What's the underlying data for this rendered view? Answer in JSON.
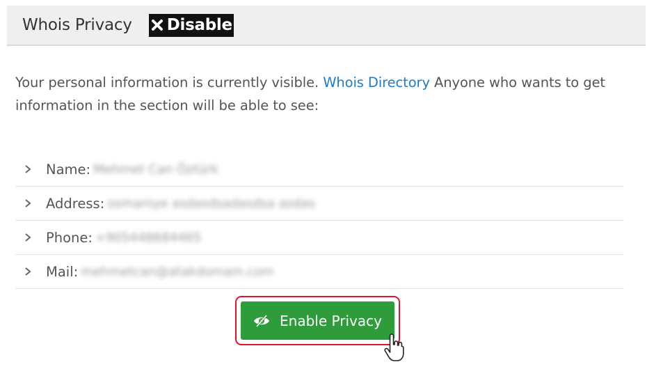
{
  "header": {
    "title": "Whois Privacy",
    "status_label": "Disable",
    "status_icon": "x-icon"
  },
  "intro": {
    "text_before": "Your personal information is currently visible. ",
    "link": "Whois Directory",
    "text_after": " Anyone who wants to get information in the section will be able to see:"
  },
  "fields": [
    {
      "label": "Name:",
      "value": "Mehmet Can Öztürk"
    },
    {
      "label": "Address:",
      "value": "osmaniye asdasdsadasdsa asdas"
    },
    {
      "label": "Phone:",
      "value": "+905448684465"
    },
    {
      "label": "Mail:",
      "value": "mehmetcan@atakdomain.com"
    }
  ],
  "action": {
    "button_label": "Enable Privacy",
    "button_icon": "eye-slash-icon",
    "button_color": "#2f9c3b",
    "highlight_color": "#e0142b"
  }
}
